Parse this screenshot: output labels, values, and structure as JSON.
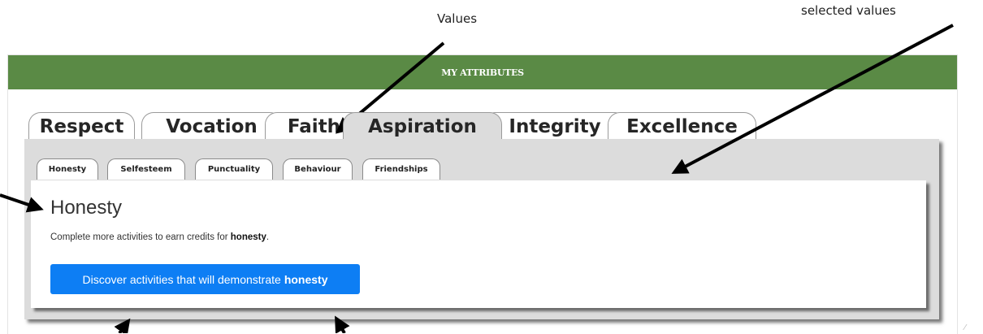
{
  "annotations": {
    "values_label": "Values",
    "selected_values_label": "selected values"
  },
  "panel": {
    "header_title": "MY ATTRIBUTES",
    "header_color": "#5a8a45"
  },
  "value_tabs": [
    {
      "label": "Respect",
      "active": false
    },
    {
      "label": "Vocation",
      "active": false
    },
    {
      "label": "Faith",
      "active": false
    },
    {
      "label": "Aspiration",
      "active": true
    },
    {
      "label": "Integrity",
      "active": false
    },
    {
      "label": "Excellence",
      "active": false
    }
  ],
  "sub_tabs": [
    {
      "label": "Honesty",
      "active": true
    },
    {
      "label": "Selfesteem",
      "active": false
    },
    {
      "label": "Punctuality",
      "active": false
    },
    {
      "label": "Behaviour",
      "active": false
    },
    {
      "label": "Friendships",
      "active": false
    }
  ],
  "content": {
    "title": "Honesty",
    "desc_prefix": "Complete more activities to earn credits for ",
    "desc_bold": "honesty",
    "desc_suffix": ".",
    "button_prefix": "Discover activities that will demonstrate",
    "button_bold": "honesty",
    "button_color": "#0d7ef4"
  }
}
